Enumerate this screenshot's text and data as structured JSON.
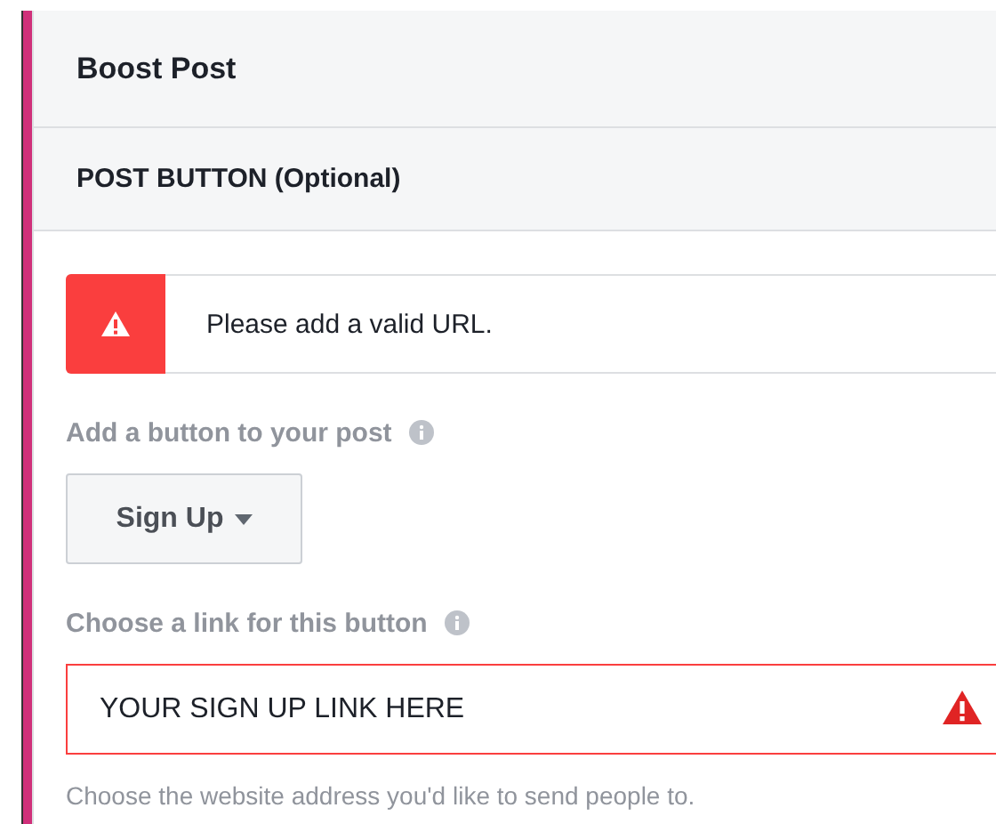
{
  "panel": {
    "title": "Boost Post"
  },
  "section": {
    "title": "POST BUTTON (Optional)"
  },
  "alert": {
    "message": "Please add a valid URL."
  },
  "button_field": {
    "label": "Add a button to your post",
    "value": "Sign Up"
  },
  "link_field": {
    "label": "Choose a link for this button",
    "value": "YOUR SIGN UP LINK HERE",
    "invalid": true,
    "help": "Choose the website address you'd like to send people to."
  }
}
